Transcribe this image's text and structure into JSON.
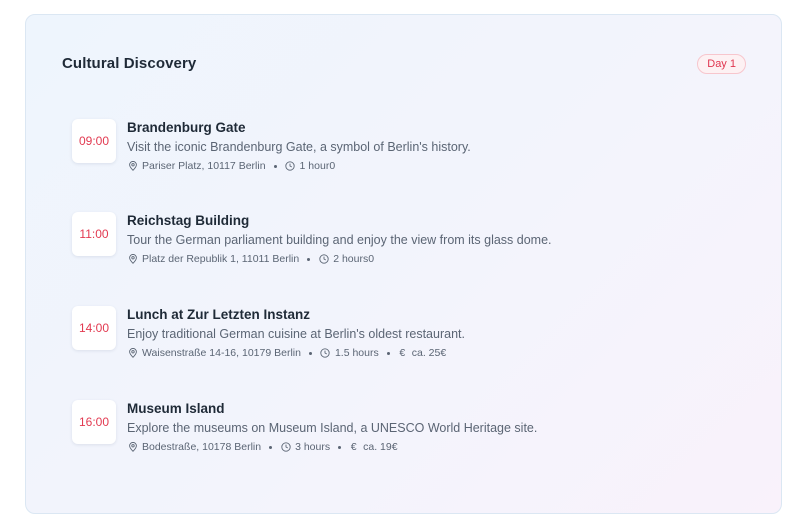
{
  "section": {
    "title": "Cultural Discovery",
    "day_badge": "Day 1"
  },
  "colors": {
    "accent": "#e23a51",
    "text_primary": "#1f2a37",
    "text_secondary": "#5b6574"
  },
  "items": [
    {
      "time": "09:00",
      "name": "Brandenburg Gate",
      "description": "Visit the iconic Brandenburg Gate, a symbol of Berlin's history.",
      "address": "Pariser Platz, 10117 Berlin",
      "duration": "1 hour0",
      "price": null
    },
    {
      "time": "11:00",
      "name": "Reichstag Building",
      "description": "Tour the German parliament building and enjoy the view from its glass dome.",
      "address": "Platz der Republik 1, 11011 Berlin",
      "duration": "2 hours0",
      "price": null
    },
    {
      "time": "14:00",
      "name": "Lunch at Zur Letzten Instanz",
      "description": "Enjoy traditional German cuisine at Berlin's oldest restaurant.",
      "address": "Waisenstraße 14-16, 10179 Berlin",
      "duration": "1.5 hours",
      "price": "ca. 25€"
    },
    {
      "time": "16:00",
      "name": "Museum Island",
      "description": "Explore the museums on Museum Island, a UNESCO World Heritage site.",
      "address": "Bodestraße, 10178 Berlin",
      "duration": "3 hours",
      "price": "ca. 19€"
    }
  ],
  "icons": {
    "location": "map-pin-icon",
    "duration": "clock-icon",
    "price": "euro-icon"
  }
}
